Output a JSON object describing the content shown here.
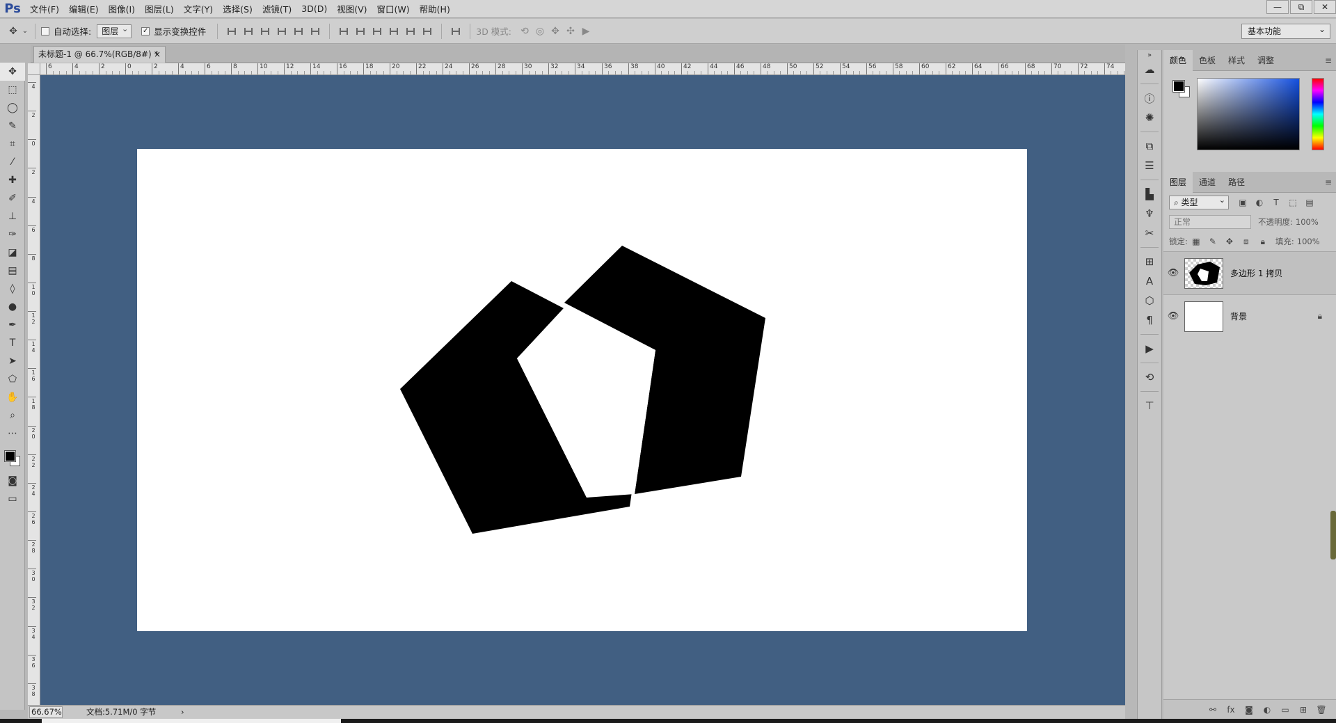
{
  "app": {
    "logo": "Ps"
  },
  "menu": [
    "文件(F)",
    "编辑(E)",
    "图像(I)",
    "图层(L)",
    "文字(Y)",
    "选择(S)",
    "滤镜(T)",
    "3D(D)",
    "视图(V)",
    "窗口(W)",
    "帮助(H)"
  ],
  "window_controls": {
    "minimize": "—",
    "restore": "⧉",
    "close": "✕"
  },
  "options": {
    "auto_select_label": "自动选择:",
    "auto_select_value": "图层",
    "show_transform_label": "显示变换控件",
    "mode_3d_label": "3D 模式:",
    "workspace": "基本功能"
  },
  "document": {
    "tab_title": "未标题-1 @ 66.7%(RGB/8#) *",
    "close_glyph": "×"
  },
  "rulers": {
    "top": [
      "6",
      "4",
      "2",
      "0",
      "2",
      "4",
      "6",
      "8",
      "10",
      "12",
      "14",
      "16",
      "18",
      "20",
      "22",
      "24",
      "26",
      "28",
      "30",
      "32",
      "34",
      "36",
      "38",
      "40",
      "42",
      "44",
      "46",
      "48",
      "50",
      "52",
      "54",
      "56",
      "58",
      "60",
      "62",
      "64",
      "66",
      "68",
      "70",
      "72",
      "74"
    ],
    "left": [
      "4",
      "2",
      "0",
      "2",
      "4",
      "6",
      "8",
      "10",
      "12",
      "14",
      "16",
      "18",
      "20",
      "22",
      "24",
      "26",
      "28",
      "30",
      "32",
      "34",
      "36",
      "38"
    ]
  },
  "status": {
    "zoom": "66.67%",
    "doc_info": "文档:5.71M/0 字节",
    "arrow": "›"
  },
  "panels": {
    "color_tabs": [
      "颜色",
      "色板",
      "样式",
      "调整"
    ],
    "layer_tabs": [
      "图层",
      "通道",
      "路径"
    ],
    "kind_filter": "类型",
    "blend_mode": "正常",
    "opacity_label": "不透明度:",
    "opacity_value": "100%",
    "lock_label": "锁定:",
    "fill_label": "填充:",
    "fill_value": "100%",
    "layers": [
      {
        "name": "多边形 1 拷贝"
      },
      {
        "name": "背景"
      }
    ]
  },
  "colors": {
    "canvas_bg": "#415f82",
    "foreground": "#000000",
    "background": "#ffffff"
  }
}
